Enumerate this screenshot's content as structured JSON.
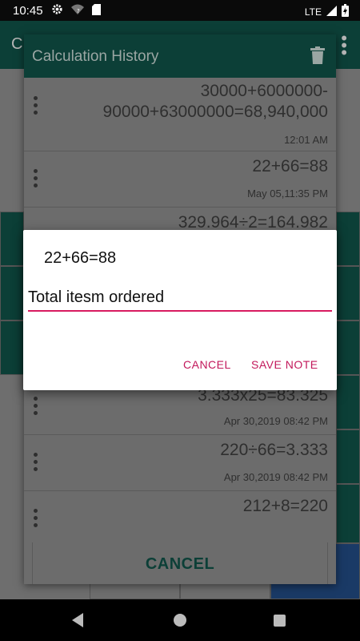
{
  "status_bar": {
    "time": "10:45",
    "network": "LTE",
    "icons": [
      "gear-icon",
      "wifi-icon",
      "sd-card-icon",
      "signal-icon",
      "battery-icon"
    ]
  },
  "background_app": {
    "title_fragment": "C"
  },
  "history": {
    "title": "Calculation History",
    "items": [
      {
        "expr": "30000+6000000-90000+63000000=68,940,000",
        "time": "12:01 AM"
      },
      {
        "expr": "22+66=88",
        "time": "May 05,11:35 PM"
      },
      {
        "expr": "329.964÷2=164.982",
        "time": ""
      },
      {
        "expr": "3.333x25=83.325",
        "time": "Apr 30,2019 08:42 PM"
      },
      {
        "expr": "220÷66=3.333",
        "time": "Apr 30,2019 08:42 PM"
      },
      {
        "expr": "212+8=220",
        "time": ""
      }
    ],
    "cancel_label": "CANCEL"
  },
  "note_dialog": {
    "title": "22+66=88",
    "input_value": "Total itesm ordered",
    "cancel_label": "CANCEL",
    "save_label": "SAVE NOTE"
  },
  "colors": {
    "accent": "#d81b60",
    "primary_dark": "#0c3f37",
    "teal": "#00796b"
  }
}
